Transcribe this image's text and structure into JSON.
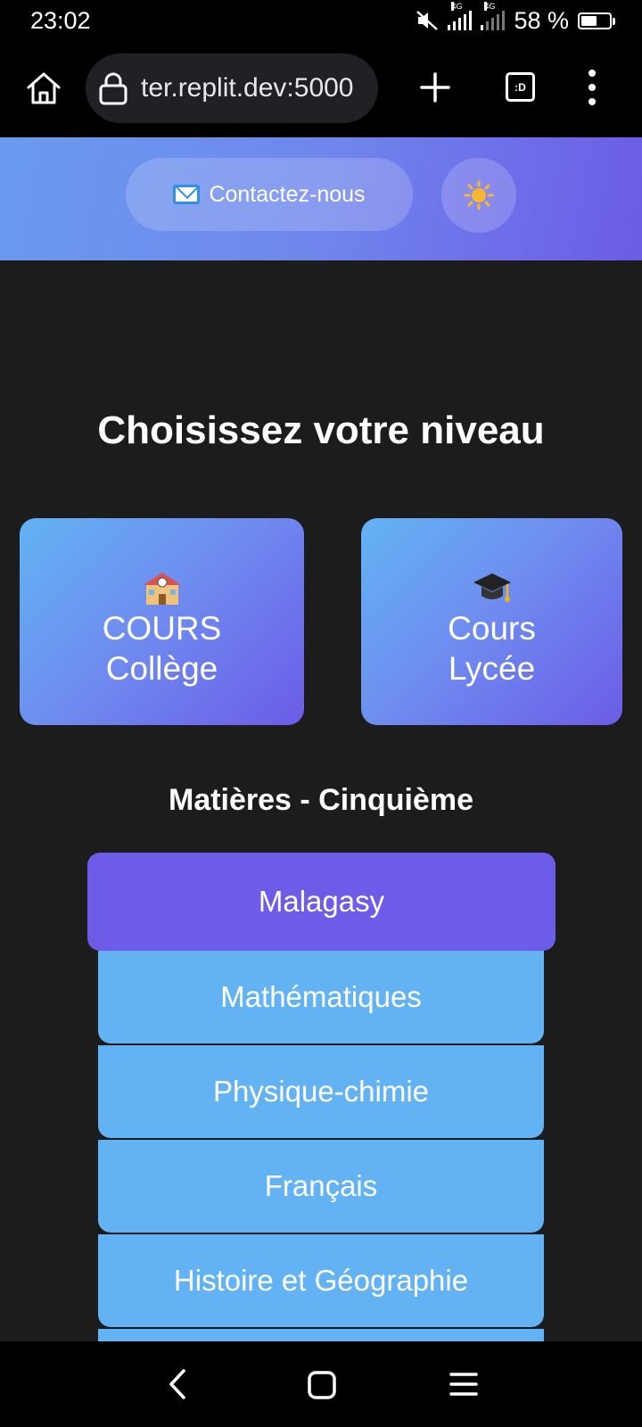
{
  "status_bar": {
    "time": "23:02",
    "network_1": "4G",
    "network_2": "4G",
    "battery_percent": "58 %",
    "battery_level": 0.58,
    "icons": [
      "mute-icon",
      "signal-icon",
      "signal-icon",
      "battery-icon"
    ]
  },
  "browser": {
    "url": "ter.replit.dev:5000",
    "tab_count_label": ":D",
    "icons": [
      "home-icon",
      "lock-icon",
      "plus-icon",
      "tab-switcher-icon",
      "more-vert-icon"
    ]
  },
  "header": {
    "contact_label": "Contactez-nous",
    "contact_icon": "envelope-icon",
    "theme_icon": "sun-icon",
    "gradient_start": "#6a9bef",
    "gradient_end": "#6c5ce7"
  },
  "main": {
    "title": "Choisissez votre niveau",
    "levels": [
      {
        "line1": "COURS",
        "line2": "Collège",
        "icon": "school-icon"
      },
      {
        "line1": "Cours",
        "line2": "Lycée",
        "icon": "graduation-cap-icon"
      }
    ],
    "subjects_title": "Matières - Cinquième",
    "subjects": [
      {
        "label": "Malagasy",
        "active": true
      },
      {
        "label": "Mathématiques",
        "active": false
      },
      {
        "label": "Physique-chimie",
        "active": false
      },
      {
        "label": "Français",
        "active": false
      },
      {
        "label": "Histoire et Géographie",
        "active": false
      }
    ]
  },
  "colors": {
    "background": "#1c1c1d",
    "active_subject": "#6c5ce7",
    "subject": "#63b3f4"
  },
  "nav_bar": {
    "icons": [
      "back-icon",
      "home-square-icon",
      "recents-icon"
    ]
  }
}
